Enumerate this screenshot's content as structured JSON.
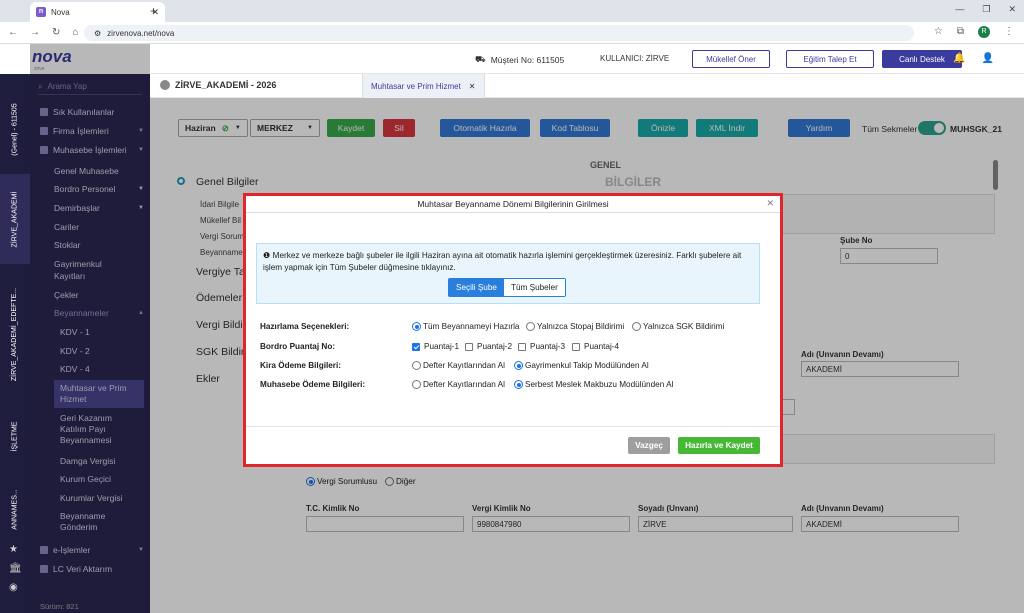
{
  "browser": {
    "tab_title": "Nova",
    "url": "zirvenova.net/nova",
    "profile_initial": "R"
  },
  "vertical_tabs": [
    {
      "label": "(Genel) - 611505"
    },
    {
      "label": "ZİRVE_AKADEMİ"
    },
    {
      "label": "ZİRVE_AKADEMİ_EDEFTE..."
    },
    {
      "label": "İŞLETME"
    },
    {
      "label": "ANNAMES..."
    }
  ],
  "logo": {
    "name": "nova",
    "sub": "zirve"
  },
  "sidebar": {
    "search_placeholder": "Arama Yap",
    "items": [
      {
        "label": "Sık Kullanılanlar"
      },
      {
        "label": "Firma İşlemleri"
      },
      {
        "label": "Muhasebe İşlemleri"
      }
    ],
    "sub": [
      {
        "label": "Genel Muhasebe"
      },
      {
        "label": "Bordro Personel"
      },
      {
        "label": "Demirbaşlar"
      },
      {
        "label": "Cariler"
      },
      {
        "label": "Stoklar"
      },
      {
        "label": "Gayrimenkul"
      },
      {
        "label": "Kayıtları"
      },
      {
        "label": "Çekler"
      },
      {
        "label": "Beyannameler"
      }
    ],
    "subsub": [
      {
        "label": "KDV - 1"
      },
      {
        "label": "KDV - 2"
      },
      {
        "label": "KDV - 4"
      },
      {
        "label": "Muhtasar ve Prim"
      },
      {
        "label": "Hizmet"
      },
      {
        "label": "Geri Kazanım"
      },
      {
        "label": "Katılım Payı"
      },
      {
        "label": "Beyannamesi"
      },
      {
        "label": "Damga Vergisi"
      },
      {
        "label": "Kurum Geçici"
      },
      {
        "label": "Kurumlar Vergisi"
      },
      {
        "label": "Beyanname"
      },
      {
        "label": "Gönderim"
      }
    ],
    "bottom_items": [
      {
        "label": "e-İşlemler"
      },
      {
        "label": "LC Veri Aktarım"
      }
    ],
    "version": "Sürüm: 821"
  },
  "header": {
    "musteri": "Müşteri No: 611505",
    "kullanici": "KULLANICI: ZİRVE",
    "btn_mukellef": "Mükellef Öner",
    "btn_egitim": "Eğitim Talep Et",
    "btn_canli": "Canlı Destek"
  },
  "crumb": {
    "company": "ZİRVE_AKADEMİ - 2026",
    "tab": "Muhtasar ve Prim Hizmet"
  },
  "toolbar": {
    "month": "Haziran",
    "branch": "MERKEZ",
    "save": "Kaydet",
    "delete": "Sil",
    "auto": "Otomatik Hazırla",
    "code_table": "Kod Tablosu",
    "preview": "Önizle",
    "xml": "XML İndir",
    "help": "Yardım",
    "all_tabs": "Tüm Sekmeler",
    "tab_code": "MUHSGK_21"
  },
  "bg": {
    "genel": "GENEL",
    "bilgiler": "BİLGİLER",
    "sections": [
      "Genel Bilgiler",
      "Vergiye Ta",
      "Ödemeler",
      "Vergi Bildir",
      "SGK Bildiri",
      "Ekler"
    ],
    "small": [
      "İdari Bilgile",
      "Mükellef Bil",
      "Vergi Sorum",
      "Beyanname"
    ],
    "sube_label": "Şube No",
    "sube_val": "0",
    "adi_label": "Adı (Unvanın Devamı)",
    "adi_val": "AKADEMİ",
    "vergi_sorumlusu": "Vergi Sorumlusu",
    "diger": "Diğer",
    "tc_label": "T.C. Kimlik No",
    "vkn_label": "Vergi Kimlik No",
    "soyadi_label": "Soyadı (Unvanı)",
    "adi2_label": "Adı (Unvanın Devamı)",
    "vkn_val": "9980847980",
    "soyadi_val": "ZİRVE",
    "adi2_val": "AKADEMİ"
  },
  "modal": {
    "title": "Muhtasar Beyanname Dönemi Bilgilerinin Girilmesi",
    "info": "Merkez ve merkeze bağlı şubeler ile ilgili Haziran ayına ait otomatik hazırla işlemini gerçekleştirmek üzeresiniz. Farklı şubelere ait işlem yapmak için Tüm Şubeler düğmesine tıklayınız.",
    "seg_selected": "Seçili Şube",
    "seg_all": "Tüm Şubeler",
    "rows": {
      "hazirlama": {
        "label": "Hazırlama Seçenekleri:",
        "opts": [
          "Tüm Beyannameyi Hazırla",
          "Yalnızca Stopaj Bildirimi",
          "Yalnızca SGK Bildirimi"
        ]
      },
      "bordro": {
        "label": "Bordro Puantaj No:",
        "opts": [
          "Puantaj-1",
          "Puantaj-2",
          "Puantaj-3",
          "Puantaj-4"
        ]
      },
      "kira": {
        "label": "Kira Ödeme Bilgileri:",
        "opts": [
          "Defter Kayıtlarından Al",
          "Gayrimenkul Takip Modülünden Al"
        ]
      },
      "muhasebe": {
        "label": "Muhasebe Ödeme Bilgileri:",
        "opts": [
          "Defter Kayıtlarından Al",
          "Serbest Meslek Makbuzu Modülünden Al"
        ]
      }
    },
    "cancel": "Vazgeç",
    "submit": "Hazırla ve Kaydet"
  },
  "colors": {
    "accent": "#3b3b9e",
    "sidebar": "#2b2853",
    "highlight": "#e0262b",
    "green": "#47b836"
  }
}
